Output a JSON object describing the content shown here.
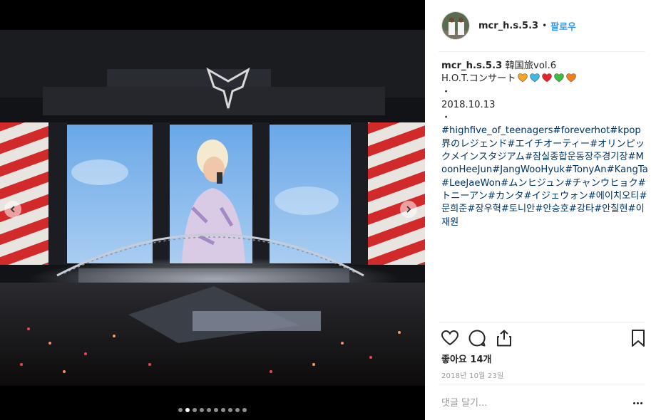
{
  "post": {
    "username": "mcr_h.s.5.3",
    "separator": "•",
    "follow_label": "팔로우"
  },
  "caption": {
    "username": "mcr_h.s.5.3",
    "line1": "韓国旅vol.6",
    "line2": "H.O.T.コンサート",
    "bullet1": "・",
    "date_text": "2018.10.13",
    "bullet2": "・",
    "hashtags": [
      "#highfive_of_teenagers",
      "#foreverhot",
      "#kpop界のレジェンド",
      "#エイチオーティー",
      "#オリンピックメインスタジアム",
      "#잠실종합운동장주경기장",
      "#MoonHeeJun",
      "#JangWooHyuk",
      "#TonyAn",
      "#KangTa",
      "#LeeJaeWon",
      "#ムンヒジュン",
      "#チャンウヒョク",
      "#トニーアン",
      "#カンタ",
      "#イジェウォン",
      "#에이치오티",
      "#문희준",
      "#장우혁",
      "#토니안",
      "#안승호",
      "#강타",
      "#안칠현",
      "#이재원"
    ],
    "heart_colors": [
      "#f5a623",
      "#3fb8e8",
      "#e8212b",
      "#3cbf3c",
      "#f57f17"
    ]
  },
  "actions": {
    "likes_text": "좋아요 14개",
    "timestamp": "2018년 10월 23일"
  },
  "comment": {
    "placeholder": "댓글 달기..."
  },
  "carousel": {
    "total": 10,
    "active_index": 1
  },
  "icons": {
    "like": "heart-icon",
    "comment": "comment-icon",
    "share": "share-icon",
    "save": "bookmark-icon",
    "more": "more-icon",
    "prev": "chevron-left-icon",
    "next": "chevron-right-icon"
  }
}
